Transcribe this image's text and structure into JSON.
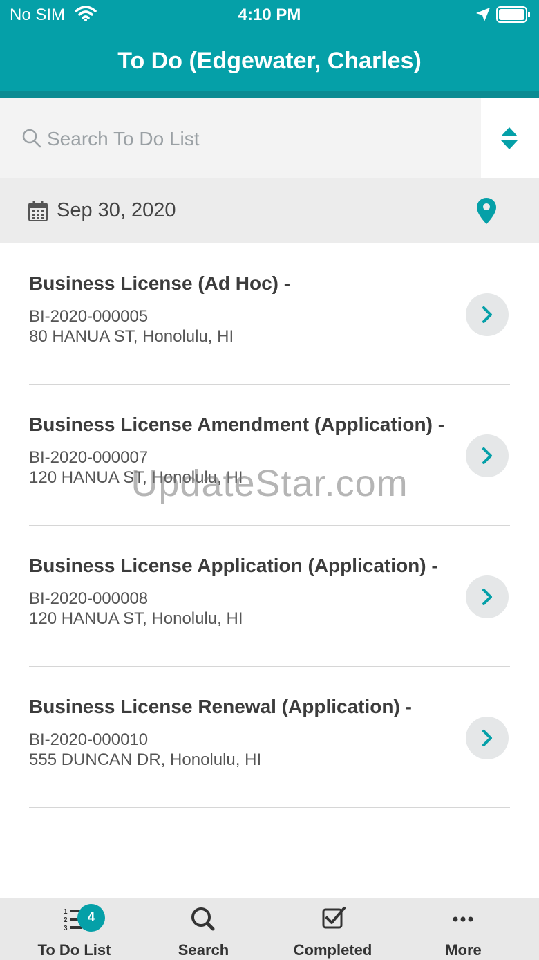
{
  "status_bar": {
    "carrier": "No SIM",
    "time": "4:10 PM",
    "icons": [
      "wifi-icon",
      "location-arrow-icon",
      "battery-icon"
    ]
  },
  "header": {
    "title": "To Do (Edgewater, Charles)"
  },
  "search": {
    "placeholder": "Search To Do List",
    "value": ""
  },
  "date_section": {
    "date": "Sep 30, 2020"
  },
  "items": [
    {
      "title": "Business License (Ad Hoc) -",
      "record_id": "BI-2020-000005",
      "address": "80 HANUA ST, Honolulu, HI"
    },
    {
      "title": "Business License Amendment (Application) -",
      "record_id": "BI-2020-000007",
      "address": "120 HANUA ST, Honolulu, HI"
    },
    {
      "title": "Business License Application (Application) -",
      "record_id": "BI-2020-000008",
      "address": "120 HANUA ST, Honolulu, HI"
    },
    {
      "title": "Business License Renewal (Application) -",
      "record_id": "BI-2020-000010",
      "address": "555 DUNCAN DR, Honolulu, HI"
    }
  ],
  "watermark": "UpdateStar.com",
  "tab_bar": {
    "tabs": [
      {
        "label": "To Do List",
        "icon": "numbered-list-icon",
        "badge": "4"
      },
      {
        "label": "Search",
        "icon": "search-icon"
      },
      {
        "label": "Completed",
        "icon": "checkbox-icon"
      },
      {
        "label": "More",
        "icon": "more-dots-icon"
      }
    ]
  },
  "colors": {
    "brand": "#05a0a8",
    "brand_dark": "#0b8b92",
    "tab_bar_bg": "#e8e8e8"
  }
}
